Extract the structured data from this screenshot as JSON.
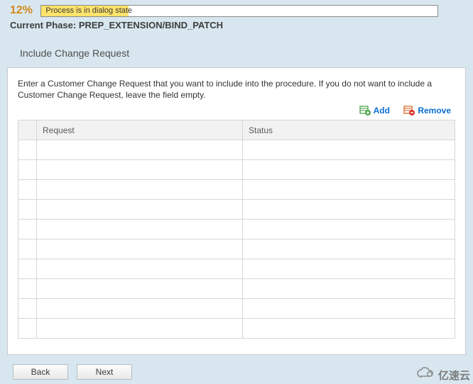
{
  "header": {
    "percent": "12%",
    "status_text": "Process is in dialog state",
    "phase_label": "Current Phase:",
    "phase_value": "PREP_EXTENSION/BIND_PATCH"
  },
  "subtitle": "Include Change Request",
  "instruction": "Enter a Customer Change Request that you want to include into the procedure. If you do not want to include a Customer Change Request, leave the field empty.",
  "toolbar": {
    "add_label": "Add",
    "remove_label": "Remove"
  },
  "table": {
    "columns": {
      "request": "Request",
      "status": "Status"
    },
    "rows": [
      {
        "request": "",
        "status": ""
      },
      {
        "request": "",
        "status": ""
      },
      {
        "request": "",
        "status": ""
      },
      {
        "request": "",
        "status": ""
      },
      {
        "request": "",
        "status": ""
      },
      {
        "request": "",
        "status": ""
      },
      {
        "request": "",
        "status": ""
      },
      {
        "request": "",
        "status": ""
      },
      {
        "request": "",
        "status": ""
      },
      {
        "request": "",
        "status": ""
      }
    ]
  },
  "buttons": {
    "back": "Back",
    "next": "Next"
  },
  "watermark": "亿速云"
}
